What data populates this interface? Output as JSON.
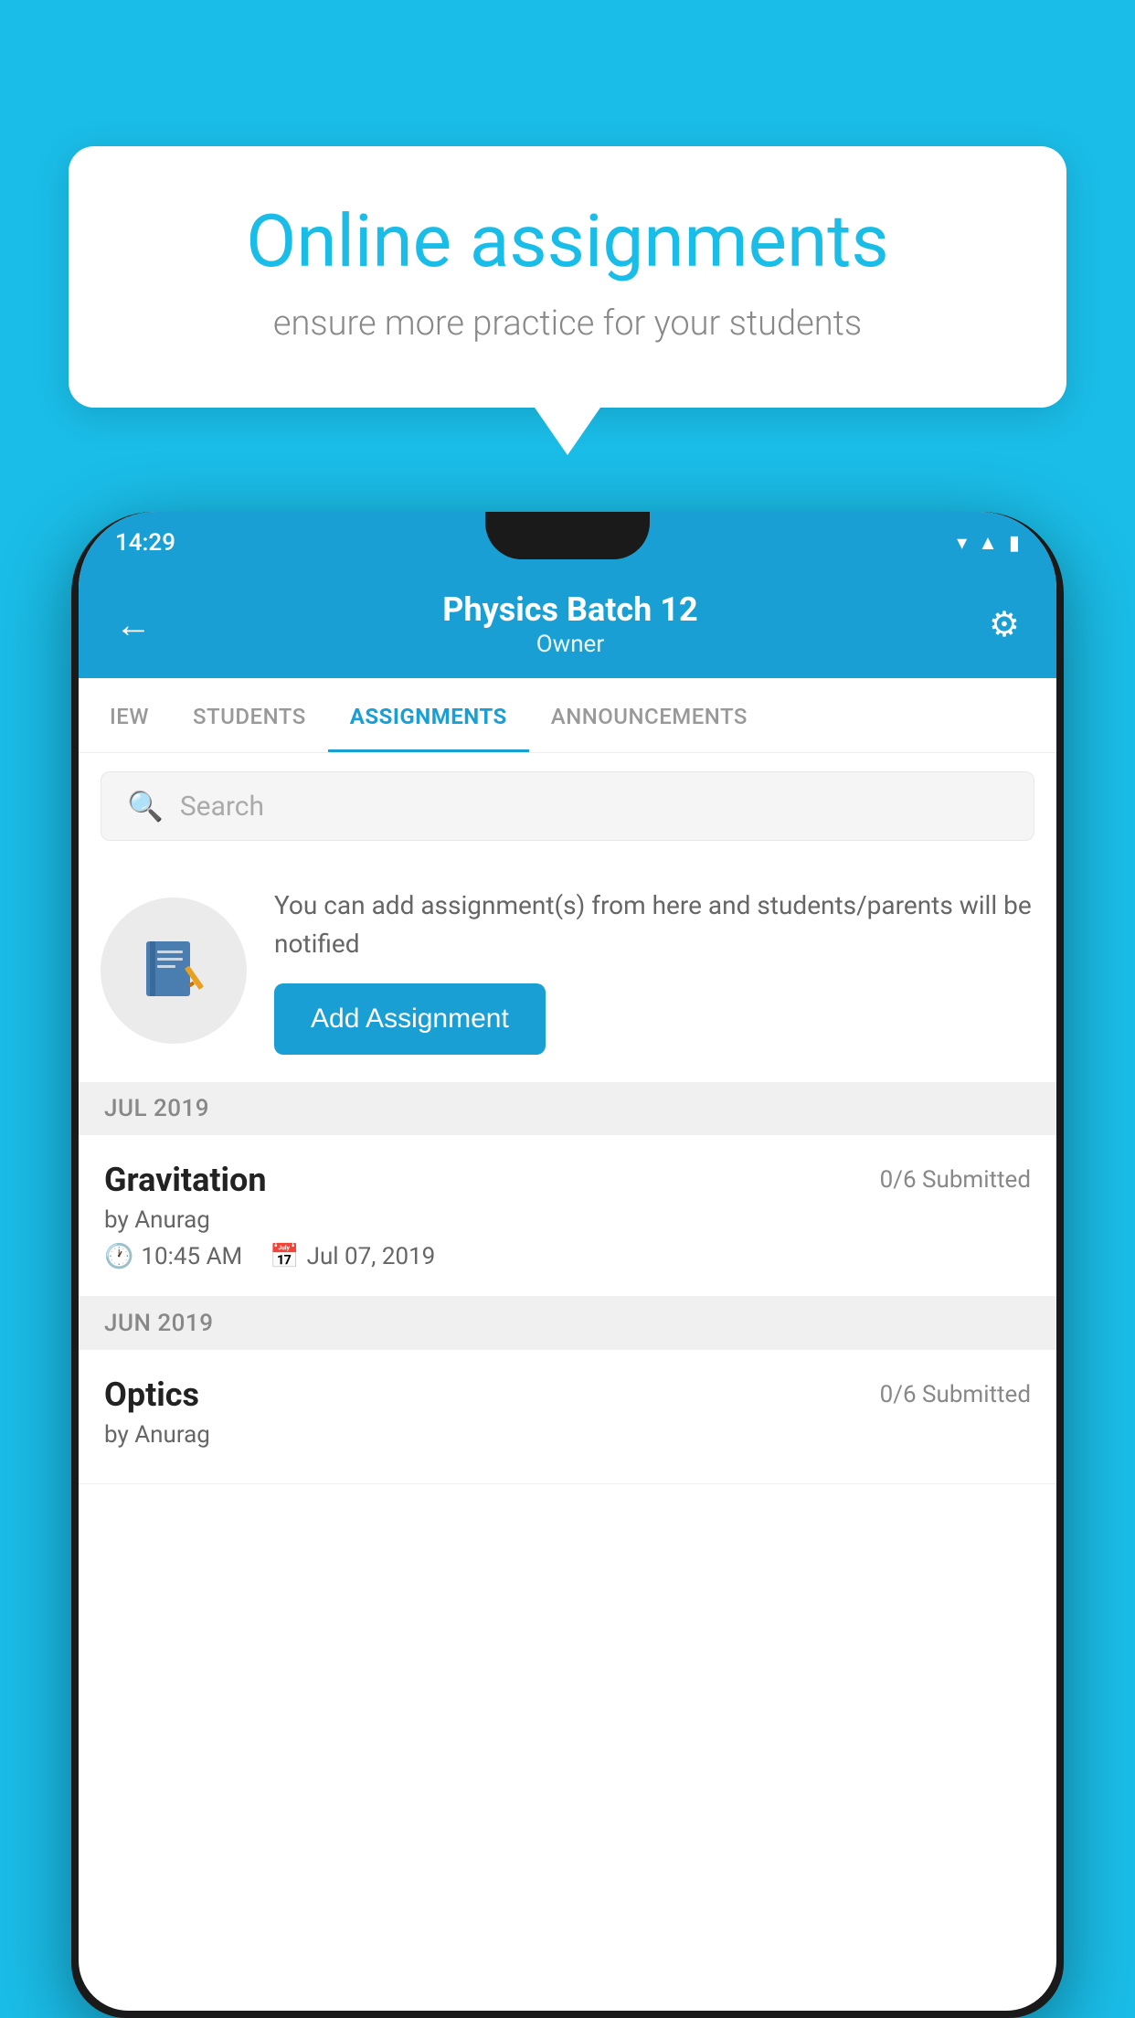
{
  "background_color": "#1ABDE8",
  "speech_bubble": {
    "title": "Online assignments",
    "subtitle": "ensure more practice for your students"
  },
  "status_bar": {
    "time": "14:29",
    "icons": [
      "wifi",
      "signal",
      "battery"
    ]
  },
  "header": {
    "title": "Physics Batch 12",
    "subtitle": "Owner",
    "back_label": "←",
    "settings_label": "⚙"
  },
  "tabs": [
    {
      "label": "IEW",
      "active": false
    },
    {
      "label": "STUDENTS",
      "active": false
    },
    {
      "label": "ASSIGNMENTS",
      "active": true
    },
    {
      "label": "ANNOUNCEMENTS",
      "active": false
    }
  ],
  "search": {
    "placeholder": "Search"
  },
  "promo": {
    "description": "You can add assignment(s) from here and students/parents will be notified",
    "button_label": "Add Assignment"
  },
  "sections": [
    {
      "month": "JUL 2019",
      "assignments": [
        {
          "name": "Gravitation",
          "submitted": "0/6 Submitted",
          "by": "by Anurag",
          "time": "10:45 AM",
          "date": "Jul 07, 2019"
        }
      ]
    },
    {
      "month": "JUN 2019",
      "assignments": [
        {
          "name": "Optics",
          "submitted": "0/6 Submitted",
          "by": "by Anurag",
          "time": "",
          "date": ""
        }
      ]
    }
  ]
}
